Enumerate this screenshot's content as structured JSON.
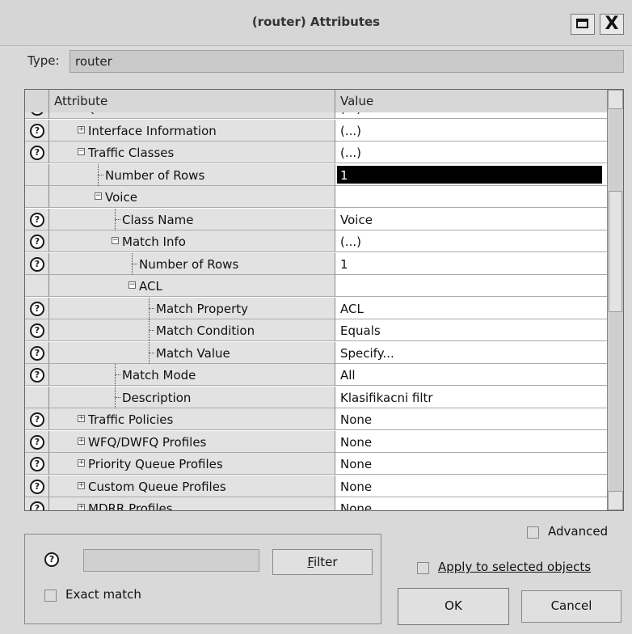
{
  "window": {
    "title": "(router) Attributes",
    "maximize_icon": "maximize-icon",
    "close_label": "X"
  },
  "type": {
    "label": "Type:",
    "value": "router"
  },
  "grid": {
    "headers": {
      "attribute": "Attribute",
      "value": "Value"
    },
    "rows": [
      {
        "label": "IP QoS Parameters",
        "value": "(...)",
        "help": true,
        "indent": 0,
        "expander": "minus",
        "partial": "top"
      },
      {
        "label": "Interface Information",
        "value": "(...)",
        "help": true,
        "indent": 1,
        "expander": "plus"
      },
      {
        "label": "Traffic Classes",
        "value": "(...)",
        "help": true,
        "indent": 1,
        "expander": "minus"
      },
      {
        "label": "Number of Rows",
        "value": "1",
        "help": false,
        "indent": 2,
        "expander": "leaf",
        "selected": true
      },
      {
        "label": "Voice",
        "value": "",
        "help": false,
        "indent": 2,
        "expander": "minus"
      },
      {
        "label": "Class Name",
        "value": "Voice",
        "help": true,
        "indent": 3,
        "expander": "leaf"
      },
      {
        "label": "Match Info",
        "value": "(...)",
        "help": true,
        "indent": 3,
        "expander": "minus"
      },
      {
        "label": "Number of Rows",
        "value": "1",
        "help": true,
        "indent": 4,
        "expander": "leaf"
      },
      {
        "label": "ACL",
        "value": "",
        "help": false,
        "indent": 4,
        "expander": "minus"
      },
      {
        "label": "Match Property",
        "value": "ACL",
        "help": true,
        "indent": 5,
        "expander": "leaf"
      },
      {
        "label": "Match Condition",
        "value": "Equals",
        "help": true,
        "indent": 5,
        "expander": "leaf"
      },
      {
        "label": "Match Value",
        "value": "Specify...",
        "help": true,
        "indent": 5,
        "expander": "leaf"
      },
      {
        "label": "Match Mode",
        "value": "All",
        "help": true,
        "indent": 3,
        "expander": "leaf"
      },
      {
        "label": "Description",
        "value": "Klasifikacni filtr",
        "help": false,
        "indent": 3,
        "expander": "leaf"
      },
      {
        "label": "Traffic Policies",
        "value": "None",
        "help": true,
        "indent": 1,
        "expander": "plus"
      },
      {
        "label": "WFQ/DWFQ Profiles",
        "value": "None",
        "help": true,
        "indent": 1,
        "expander": "plus"
      },
      {
        "label": "Priority Queue Profiles",
        "value": "None",
        "help": true,
        "indent": 1,
        "expander": "plus"
      },
      {
        "label": "Custom Queue Profiles",
        "value": "None",
        "help": true,
        "indent": 1,
        "expander": "plus"
      },
      {
        "label": "MDRR Profiles",
        "value": "None",
        "help": true,
        "indent": 1,
        "expander": "plus",
        "partial": "bottom"
      }
    ]
  },
  "filter": {
    "button": "Filter",
    "button_mnemonic": "F",
    "exact_match": "Exact match",
    "input_value": ""
  },
  "options": {
    "advanced": "Advanced",
    "apply_selected": "Apply to selected objects"
  },
  "buttons": {
    "ok": "OK",
    "cancel": "Cancel"
  },
  "icons": {
    "help": "help-icon"
  }
}
